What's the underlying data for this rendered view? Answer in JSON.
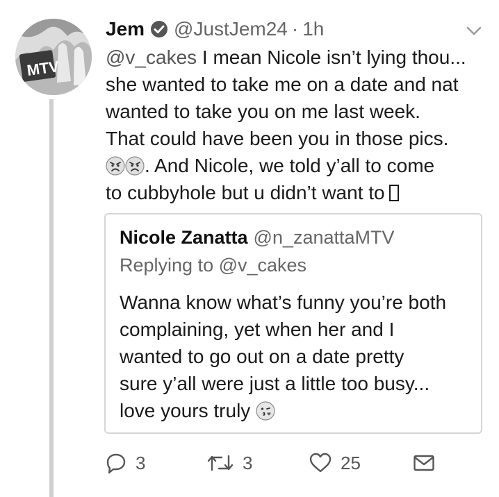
{
  "tweet": {
    "display_name": "Jem",
    "handle": "@JustJem24",
    "separator": "·",
    "time": "1h",
    "avatar_logo": "MTV",
    "text_lines": {
      "l1_mention": "@v_cakes",
      "l1_rest": " I mean Nicole isn’t lying thou...",
      "l2": "she wanted to take me on a date and nat",
      "l3": "wanted to take you on me last week.",
      "l4": "That could have been you in those pics.",
      "l5_rest": ".  And Nicole, we told y’all to come",
      "l6": "to cubbyhole but u didn’t want to"
    },
    "emoji_l5": [
      "angry-face-emoji",
      "angry-face-emoji"
    ],
    "emoji_l6": "missing-glyph-box"
  },
  "quote": {
    "name": "Nicole Zanatta",
    "handle": "@n_zanattaMTV",
    "replying_to": "Replying to @v_cakes",
    "text_lines": {
      "l1": "Wanna know what’s funny you’re both",
      "l2": "complaining, yet when her and I",
      "l3": "wanted to go out on a date pretty",
      "l4": "sure y’all were just a little too busy...",
      "l5": "love yours truly"
    },
    "emoji_l5": "face-blowing-kiss-emoji"
  },
  "actions": {
    "reply_count": "3",
    "retweet_count": "3",
    "like_count": "25"
  },
  "colors": {
    "text": "#1a1a1a",
    "secondary": "#666666",
    "border": "#d6d6d6",
    "thread_line": "#cfcfcf"
  }
}
